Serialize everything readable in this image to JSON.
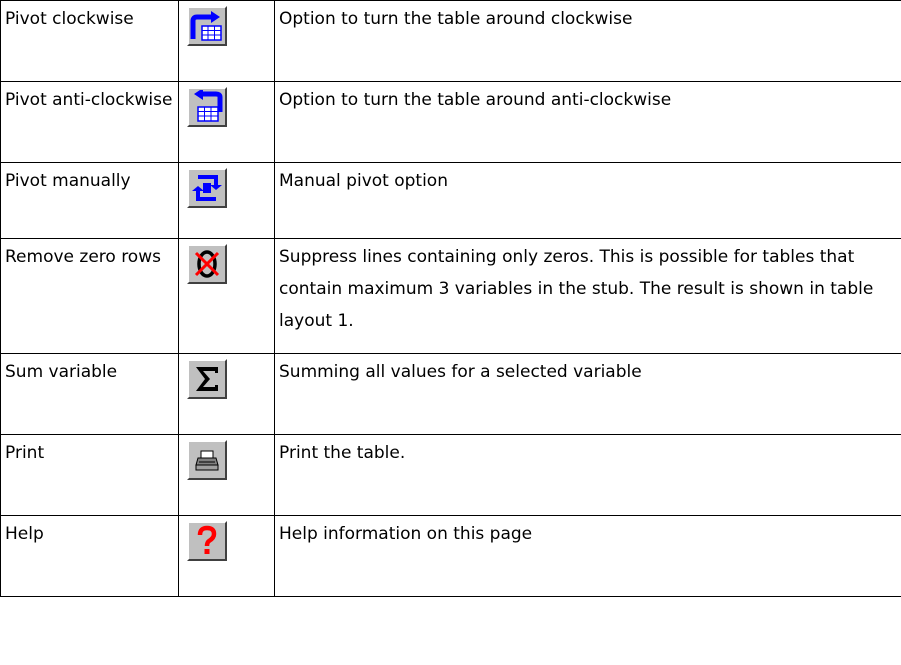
{
  "rows": [
    {
      "label": "Pivot clockwise",
      "icon": "pivot-clockwise-icon",
      "description": "Option to turn the table around clockwise"
    },
    {
      "label": "Pivot anti-clockwise",
      "icon": "pivot-anticlockwise-icon",
      "description": "Option to turn the table around anti-clockwise"
    },
    {
      "label": "Pivot manually",
      "icon": "pivot-manual-icon",
      "description": "Manual pivot option"
    },
    {
      "label": "Remove zero rows",
      "icon": "remove-zero-rows-icon",
      "description": "Suppress lines containing only zeros. This is possible for tables that contain maximum 3 variables in the stub. The result is shown in table layout 1."
    },
    {
      "label": "Sum variable",
      "icon": "sigma-icon",
      "description": "Summing all values for a selected variable"
    },
    {
      "label": "Print",
      "icon": "printer-icon",
      "description": "Print the table."
    },
    {
      "label": "Help",
      "icon": "question-mark-icon",
      "description": "Help information on this page"
    }
  ],
  "colors": {
    "border": "#000000",
    "icon_blue": "#0000ff",
    "icon_red": "#ff0000",
    "button_face": "#c0c0c0"
  }
}
